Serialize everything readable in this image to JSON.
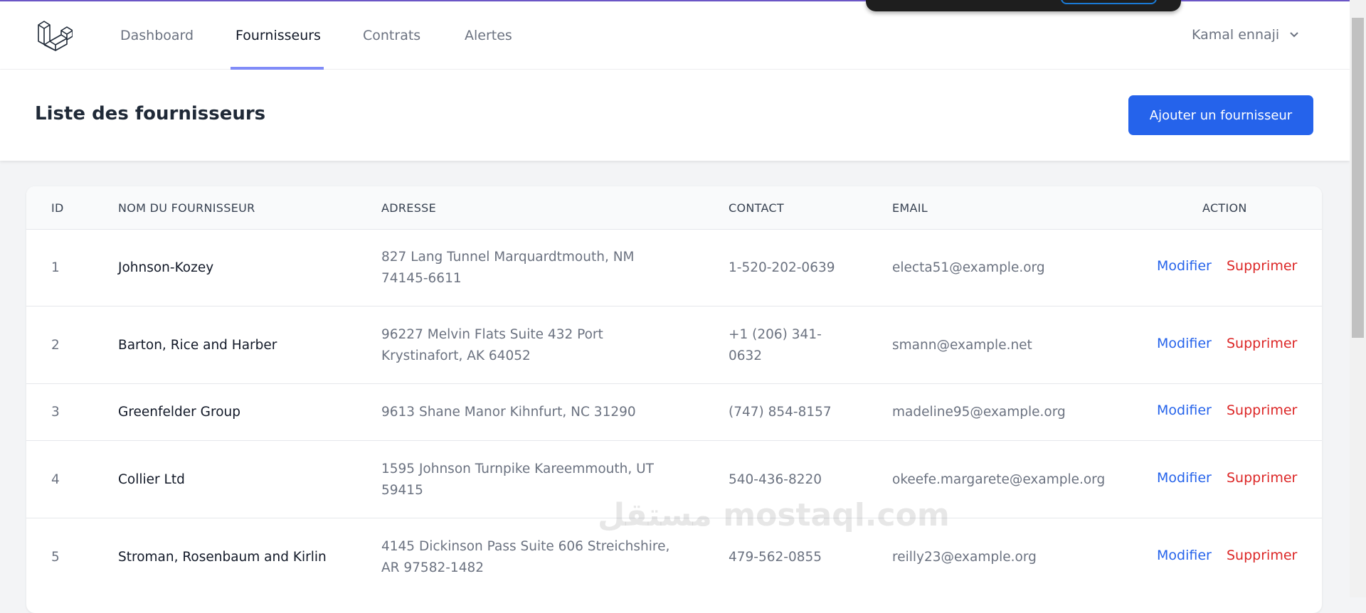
{
  "nav": {
    "items": [
      "Dashboard",
      "Fournisseurs",
      "Contrats",
      "Alertes"
    ],
    "active": "Fournisseurs",
    "user": "Kamal ennaji"
  },
  "header": {
    "title": "Liste des fournisseurs",
    "add_button": "Ajouter un fournisseur"
  },
  "table": {
    "columns": [
      "ID",
      "NOM DU FOURNISSEUR",
      "ADRESSE",
      "CONTACT",
      "EMAIL",
      "ACTION"
    ],
    "rows": [
      {
        "id": "1",
        "name": "Johnson-Kozey",
        "address": "827 Lang Tunnel Marquardtmouth, NM 74145-6611",
        "contact": "1-520-202-0639",
        "email": "electa51@example.org"
      },
      {
        "id": "2",
        "name": "Barton, Rice and Harber",
        "address": "96227 Melvin Flats Suite 432 Port Krystinafort, AK 64052",
        "contact": "+1 (206) 341-0632",
        "email": "smann@example.net"
      },
      {
        "id": "3",
        "name": "Greenfelder Group",
        "address": "9613 Shane Manor Kihnfurt, NC 31290",
        "contact": "(747) 854-8157",
        "email": "madeline95@example.org"
      },
      {
        "id": "4",
        "name": "Collier Ltd",
        "address": "1595 Johnson Turnpike Kareemmouth, UT 59415",
        "contact": "540-436-8220",
        "email": "okeefe.margarete@example.org"
      },
      {
        "id": "5",
        "name": "Stroman, Rosenbaum and Kirlin",
        "address": "4145 Dickinson Pass Suite 606 Streichshire, AR 97582-1482",
        "contact": "479-562-0855",
        "email": "reilly23@example.org"
      }
    ],
    "edit_label": "Modifier",
    "delete_label": "Supprimer"
  },
  "watermark": "مستقل mostaql.com",
  "colors": {
    "primary": "#2563eb",
    "danger": "#dc2626",
    "nav_accent": "#818cf8"
  }
}
